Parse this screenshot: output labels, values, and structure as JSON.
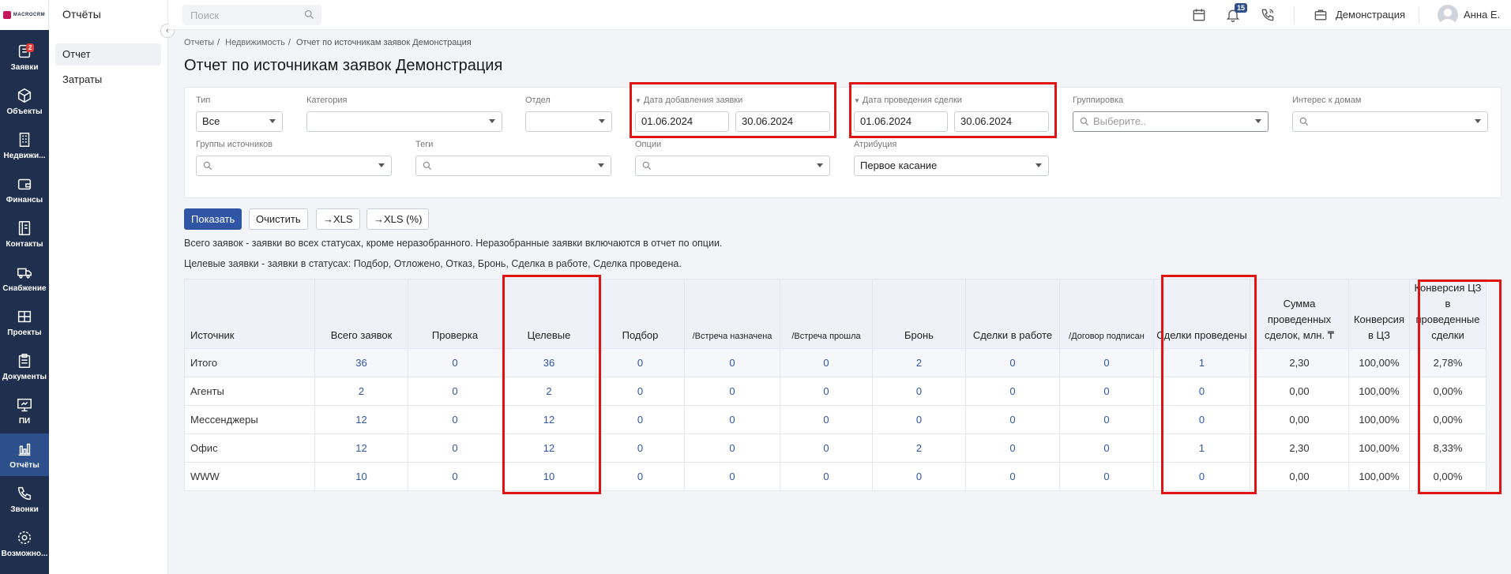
{
  "brand": {
    "logo_text": "MACROCRM"
  },
  "rail": {
    "items": [
      {
        "label": "Заявки",
        "icon": "requests-icon",
        "badge": "2"
      },
      {
        "label": "Объекты",
        "icon": "cube-icon"
      },
      {
        "label": "Недвижи...",
        "icon": "building-icon"
      },
      {
        "label": "Финансы",
        "icon": "wallet-icon"
      },
      {
        "label": "Контакты",
        "icon": "contacts-icon"
      },
      {
        "label": "Снабжение",
        "icon": "truck-icon"
      },
      {
        "label": "Проекты",
        "icon": "projects-icon"
      },
      {
        "label": "Документы",
        "icon": "clipboard-icon"
      },
      {
        "label": "ПИ",
        "icon": "presentation-icon"
      },
      {
        "label": "Отчёты",
        "icon": "chart-icon",
        "active": true
      },
      {
        "label": "Звонки",
        "icon": "phone-icon"
      },
      {
        "label": "Возможно...",
        "icon": "gear-icon"
      }
    ]
  },
  "subnav": {
    "title": "Отчёты",
    "items": [
      "Отчет",
      "Затраты"
    ]
  },
  "topbar": {
    "search_placeholder": "Поиск",
    "notifications_count": "15",
    "company": "Демонстрация",
    "user": "Анна Е."
  },
  "breadcrumb": [
    "Отчеты",
    "Недвижимость",
    "Отчет по источникам заявок Демонстрация"
  ],
  "page_title": "Отчет по источникам заявок Демонстрация",
  "filters": {
    "type": {
      "label": "Тип",
      "value": "Все"
    },
    "category": {
      "label": "Категория",
      "value": ""
    },
    "department": {
      "label": "Отдел",
      "value": ""
    },
    "request_date": {
      "label": "Дата добавления заявки",
      "from": "01.06.2024",
      "to": "30.06.2024"
    },
    "deal_date": {
      "label": "Дата проведения сделки",
      "from": "01.06.2024",
      "to": "30.06.2024"
    },
    "grouping": {
      "label": "Группировка",
      "placeholder": "Выберите.."
    },
    "interest": {
      "label": "Интерес к домам"
    },
    "source_groups": {
      "label": "Группы источников"
    },
    "tags": {
      "label": "Теги"
    },
    "options": {
      "label": "Опции"
    },
    "attribution": {
      "label": "Атрибуция",
      "value": "Первое касание"
    }
  },
  "actions": {
    "show": "Показать",
    "clear": "Очистить",
    "xls": "→XLS",
    "xls_pct": "→XLS (%)"
  },
  "notes": [
    "Всего заявок - заявки во всех статусах, кроме неразобранного. Неразобранные заявки включаются в отчет по опции.",
    "Целевые заявки - заявки в статусах: Подбор, Отложено, Отказ, Бронь, Сделка в работе, Сделка проведена."
  ],
  "table": {
    "headers": [
      "Источник",
      "Всего заявок",
      "Проверка",
      "Целевые",
      "Подбор",
      "/Встреча назначена",
      "/Встреча прошла",
      "Бронь",
      "Сделки в работе",
      "/Договор подписан",
      "Сделки проведены",
      "Сумма проведенных сделок, млн. ₸",
      "Конверсия в ЦЗ",
      "Конверсия ЦЗ в проведенные сделки"
    ],
    "rows": [
      [
        "Итого",
        "36",
        "0",
        "36",
        "0",
        "0",
        "0",
        "2",
        "0",
        "0",
        "1",
        "2,30",
        "100,00%",
        "2,78%"
      ],
      [
        "Агенты",
        "2",
        "0",
        "2",
        "0",
        "0",
        "0",
        "0",
        "0",
        "0",
        "0",
        "0,00",
        "100,00%",
        "0,00%"
      ],
      [
        "Мессенджеры",
        "12",
        "0",
        "12",
        "0",
        "0",
        "0",
        "0",
        "0",
        "0",
        "0",
        "0,00",
        "100,00%",
        "0,00%"
      ],
      [
        "Офис",
        "12",
        "0",
        "12",
        "0",
        "0",
        "0",
        "2",
        "0",
        "0",
        "1",
        "2,30",
        "100,00%",
        "8,33%"
      ],
      [
        "WWW",
        "10",
        "0",
        "10",
        "0",
        "0",
        "0",
        "0",
        "0",
        "0",
        "0",
        "0,00",
        "100,00%",
        "0,00%"
      ]
    ]
  }
}
